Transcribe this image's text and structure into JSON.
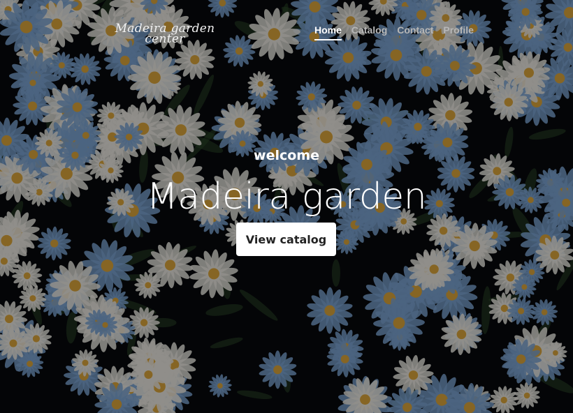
{
  "brand": {
    "line1": "Madeira garden",
    "line2": "center"
  },
  "nav": {
    "items": [
      {
        "label": "Home",
        "active": true
      },
      {
        "label": "Catalog",
        "active": false
      },
      {
        "label": "Contact",
        "active": false
      },
      {
        "label": "Profile",
        "active": false
      }
    ]
  },
  "hero": {
    "welcome": "welcome",
    "title": "Madeira garden",
    "cta_label": "View catalog",
    "background": "daisy-field-photo"
  },
  "colors": {
    "overlay": "#000000",
    "petal_white": "#e8e6df",
    "petal_blue": "#7aa2cf",
    "flower_center": "#d9a43a",
    "button_bg": "#ffffff",
    "nav_active": "#ffffff",
    "nav_inactive": "#b7b7b7"
  }
}
